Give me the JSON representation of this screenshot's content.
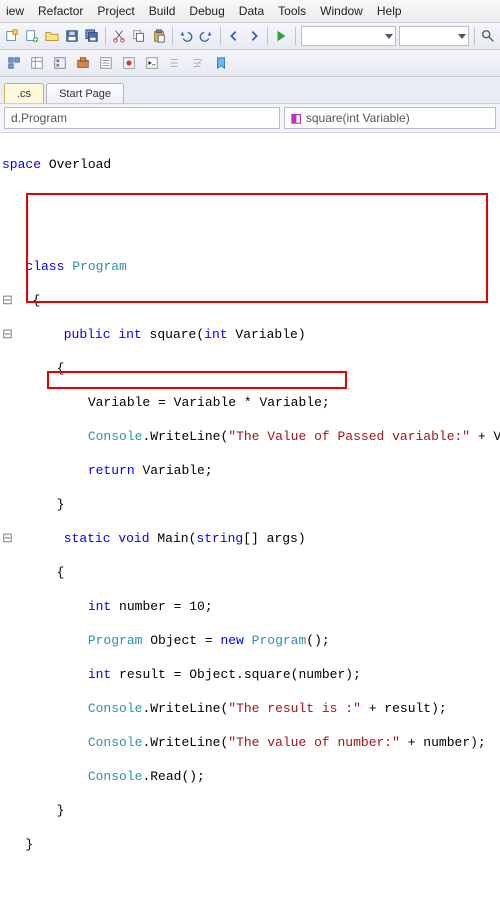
{
  "menu": {
    "items": [
      "iew",
      "Refactor",
      "Project",
      "Build",
      "Debug",
      "Data",
      "Tools",
      "Window",
      "Help"
    ]
  },
  "tabs": {
    "active": ".cs",
    "other": "Start Page"
  },
  "nav": {
    "left": "d.Program",
    "right": "square(int Variable)"
  },
  "code": {
    "ns": "space",
    "nsname": "Overload",
    "cls_kw": "class",
    "cls_name": "Program",
    "lbrace": "{",
    "rbrace": "}",
    "m1_mods": "public int",
    "m1_name": "square",
    "m1_params_kw": "int",
    "m1_params_nm": "Variable",
    "m1_l1a": "Variable = Variable * Variable;",
    "m1_l2a": "Console",
    "m1_l2b": ".WriteLine(",
    "m1_l2s": "\"The Value of Passed variable:\"",
    "m1_l2c": " + Variable)",
    "m1_ret_kw": "return",
    "m1_ret_v": " Variable;",
    "m2_mods": "static void",
    "m2_name": "Main",
    "m2_params_kw": "string",
    "m2_params_br": "[]",
    "m2_params_nm": " args",
    "m2_l1_kw": "int",
    "m2_l1_r": " number = 10;",
    "m2_l2_typ": "Program",
    "m2_l2_mid": " Object = ",
    "m2_l2_new": "new",
    "m2_l2_sp": " ",
    "m2_l2_typ2": "Program",
    "m2_l2_end": "();",
    "m2_l3_kw": "int",
    "m2_l3_r": " result = Object.square(number);",
    "m2_l4a": "Console",
    "m2_l4b": ".WriteLine(",
    "m2_l4s": "\"The result is :\"",
    "m2_l4c": " + result);",
    "m2_l5a": "Console",
    "m2_l5b": ".WriteLine(",
    "m2_l5s": "\"The value of number:\"",
    "m2_l5c": " + number);",
    "m2_l6a": "Console",
    "m2_l6b": ".Read();",
    "semi": ";"
  }
}
